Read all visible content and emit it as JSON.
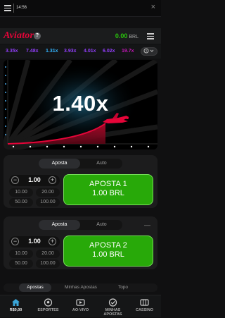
{
  "status_bar": {
    "time": "14:56",
    "close_glyph": "×"
  },
  "header": {
    "logo": "Aviator",
    "help_glyph": "?",
    "balance_amount": "0.00",
    "balance_currency": "BRL"
  },
  "multiplier_history": [
    {
      "value": "3.35x",
      "color": "#913ef8"
    },
    {
      "value": "7.48x",
      "color": "#913ef8"
    },
    {
      "value": "1.31x",
      "color": "#34b4ff"
    },
    {
      "value": "3.93x",
      "color": "#913ef8"
    },
    {
      "value": "4.01x",
      "color": "#913ef8"
    },
    {
      "value": "6.02x",
      "color": "#913ef8"
    },
    {
      "value": "19.7x",
      "color": "#c017b4"
    }
  ],
  "game": {
    "current_multiplier": "1.40x",
    "accent": "#e50539"
  },
  "bet_panels": [
    {
      "tabs": [
        "Aposta",
        "Auto"
      ],
      "active_tab": "Aposta",
      "amount": "1.00",
      "quick_amounts": [
        "10.00",
        "20.00",
        "50.00",
        "100.00"
      ],
      "button_line1": "APOSTA 1",
      "button_line2": "1.00 BRL"
    },
    {
      "tabs": [
        "Aposta",
        "Auto"
      ],
      "active_tab": "Aposta",
      "amount": "1.00",
      "quick_amounts": [
        "10.00",
        "20.00",
        "50.00",
        "100.00"
      ],
      "button_line1": "APOSTA 2",
      "button_line2": "1.00 BRL",
      "collapse_glyph": "—"
    }
  ],
  "bottom_tabs": [
    "Apostas",
    "Minhas Apostas",
    "Topo"
  ],
  "bottom_nav": [
    {
      "label": "R$0,00",
      "icon": "home-icon",
      "active": true
    },
    {
      "label": "ESPORTES",
      "icon": "soccer-ball-icon",
      "active": false
    },
    {
      "label": "AO-VIVO",
      "icon": "live-icon",
      "active": false
    },
    {
      "label": "MINHAS APOSTAS",
      "icon": "check-circle-icon",
      "active": false
    },
    {
      "label": "CASSINO",
      "icon": "slot-machine-icon",
      "active": false
    }
  ],
  "colors": {
    "green": "#28a909",
    "balance_green": "#29c30c",
    "brand_red": "#e50539"
  }
}
